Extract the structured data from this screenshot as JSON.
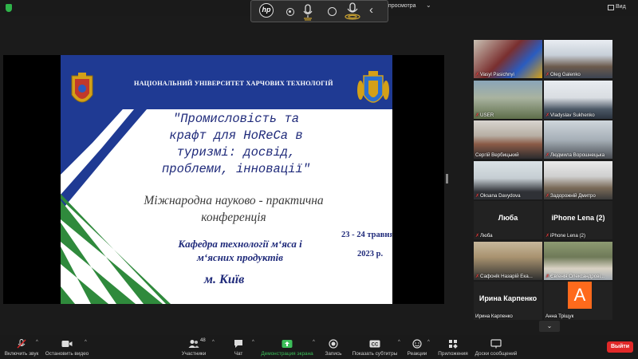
{
  "topbar": {
    "view_options": "ки просмотра",
    "view_button": "Вид",
    "icons": [
      "security-shield-icon",
      "hp-logo-icon",
      "record-icon",
      "mic-icon",
      "camera-ring-icon",
      "mic-active-icon",
      "chevron-left-icon"
    ]
  },
  "slide": {
    "university": "НАЦІОНАЛЬНИЙ УНІВЕРСИТЕТ ХАРЧОВИХ ТЕХНОЛОГІЙ",
    "title_lines": [
      "\"Промисловість та",
      "крафт для HoReCa в",
      "туризмі: досвід,",
      "проблеми, інновації\""
    ],
    "subtitle_lines": [
      "Міжнародна науково - практична",
      "конференція"
    ],
    "department_lines": [
      "Кафедра технології м‘яса і",
      "м‘ясних продуктів"
    ],
    "dates": "23 - 24 травня",
    "year": "2023 р.",
    "city": "м. Київ",
    "colors": {
      "navy": "#1f3a93",
      "green": "#2f8a3c",
      "text": "#1f2a7a"
    }
  },
  "gallery": {
    "tiles": [
      {
        "name": "Vasyl Pasichnyi",
        "muted": true,
        "kind": "video"
      },
      {
        "name": "Oleg Galenko",
        "muted": true,
        "kind": "video"
      },
      {
        "name": "USER",
        "muted": true,
        "kind": "video"
      },
      {
        "name": "Vladyslav Sukhenko",
        "muted": true,
        "kind": "video"
      },
      {
        "name": "Сергій Вербицький",
        "muted": false,
        "kind": "video",
        "active": true
      },
      {
        "name": "Людмила Ворошнецька",
        "muted": true,
        "kind": "video"
      },
      {
        "name": "Oksana Davydova",
        "muted": true,
        "kind": "video"
      },
      {
        "name": "Задорожній Дмитро",
        "muted": true,
        "kind": "video"
      },
      {
        "name": "Люба",
        "muted": true,
        "kind": "name",
        "center": "Люба"
      },
      {
        "name": "iPhone Lena (2)",
        "muted": true,
        "kind": "name",
        "center": "iPhone Lena (2)"
      },
      {
        "name": "Сафоніk Назарій Ека...",
        "muted": true,
        "kind": "video"
      },
      {
        "name": "Євгенія Олександрові...",
        "muted": true,
        "kind": "video"
      },
      {
        "name": "Ирина Карпенко",
        "muted": false,
        "kind": "name",
        "center": "Ирина Карпенко"
      },
      {
        "name": "Анна Тріщук",
        "muted": false,
        "kind": "avatar",
        "avatar_letter": "A"
      }
    ]
  },
  "toolbar": {
    "mute": "Включить звук",
    "video": "Остановить видео",
    "participants": "Участники",
    "participants_count": "48",
    "chat": "Чат",
    "share": "Демонстрация экрана",
    "record": "Запись",
    "captions": "Показать субтитры",
    "reactions": "Реакции",
    "apps": "Приложения",
    "whiteboards": "Доски сообщений",
    "exit": "Выйти",
    "share_color": "#3cbf5a",
    "exit_color": "#e02828"
  }
}
